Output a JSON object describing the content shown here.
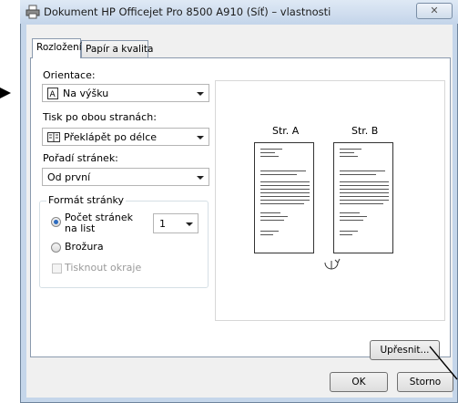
{
  "window": {
    "title": "Dokument HP Officejet Pro 8500 A910 (Síť) – vlastnosti",
    "close_glyph": "✕"
  },
  "tabs": [
    {
      "label": "Rozložení",
      "active": true
    },
    {
      "label": "Papír a kvalita",
      "active": false
    }
  ],
  "layout": {
    "orientation_label": "Orientace:",
    "orientation_value": "Na výšku",
    "duplex_label": "Tisk po obou stranách:",
    "duplex_value": "Překlápět po délce",
    "page_order_label": "Pořadí stránek:",
    "page_order_value": "Od první",
    "format_group_label": "Formát stránky",
    "pages_per_sheet_label": "Počet stránek na list",
    "pages_per_sheet_value": "1",
    "booklet_label": "Brožura",
    "print_borders_label": "Tisknout okraje"
  },
  "preview": {
    "page_a": "Str. A",
    "page_b": "Str. B"
  },
  "buttons": {
    "advanced": "Upřesnit...",
    "ok": "OK",
    "cancel": "Storno"
  },
  "colors": {
    "accent": "#2d6cc0",
    "title_bg": "#c4d5ea"
  }
}
